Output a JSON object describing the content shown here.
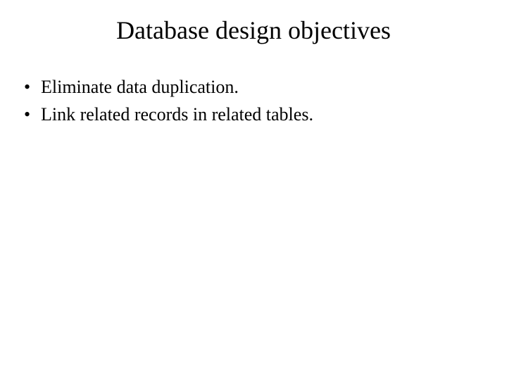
{
  "slide": {
    "title": "Database design objectives",
    "bullets": [
      "Eliminate data duplication.",
      "Link related records in related tables."
    ]
  }
}
